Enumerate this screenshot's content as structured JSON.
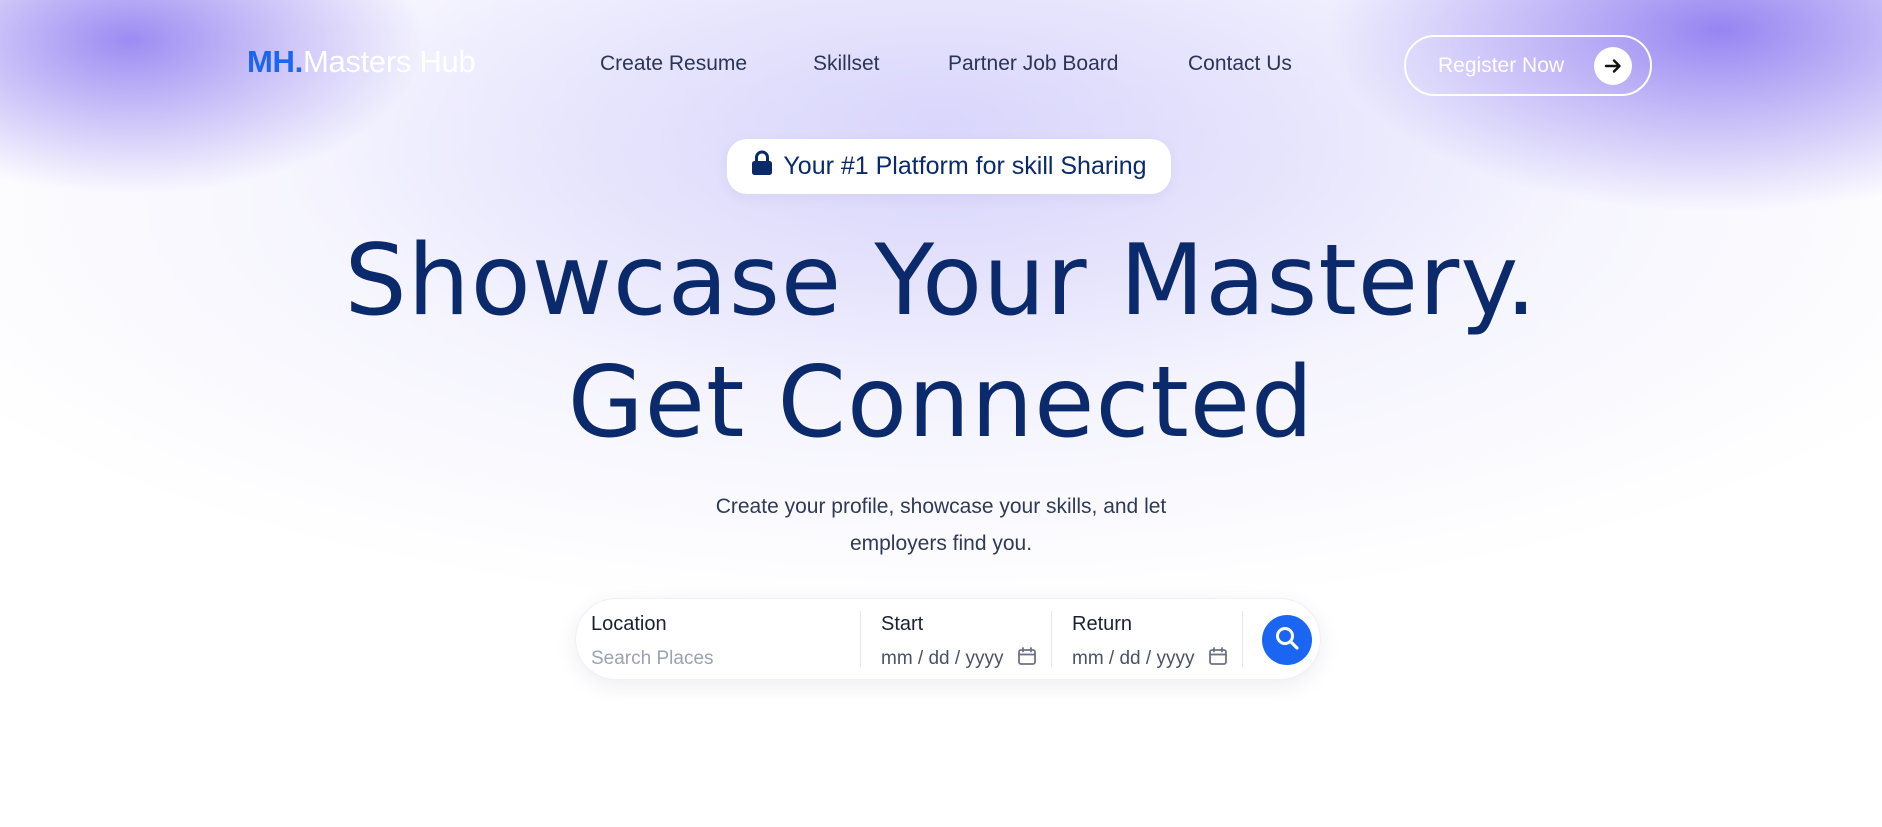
{
  "nav": {
    "logo_mark": "MH.",
    "logo_text": "Masters Hub",
    "links": [
      "Create Resume",
      "Skillset",
      "Partner Job Board",
      "Contact Us"
    ],
    "register_label": "Register Now"
  },
  "hero": {
    "badge_text": "Your #1 Platform for skill Sharing",
    "headline_line1": "Showcase Your Mastery.",
    "headline_line2": "Get Connected",
    "subtitle_line1": "Create your profile, showcase your skills, and let",
    "subtitle_line2": "employers find you."
  },
  "search": {
    "location_label": "Location",
    "location_placeholder": "Search Places",
    "start_label": "Start",
    "start_value": "mm / dd / yyyy",
    "return_label": "Return",
    "return_value": "mm / dd / yyyy"
  },
  "icons": {
    "badge": "lock-icon",
    "register": "arrow-right-icon",
    "date": "calendar-icon",
    "search": "search-icon"
  },
  "colors": {
    "brand_blue": "#1a66f2",
    "heading_navy": "#0b2a6b",
    "glow_purple": "#8c78f0"
  }
}
